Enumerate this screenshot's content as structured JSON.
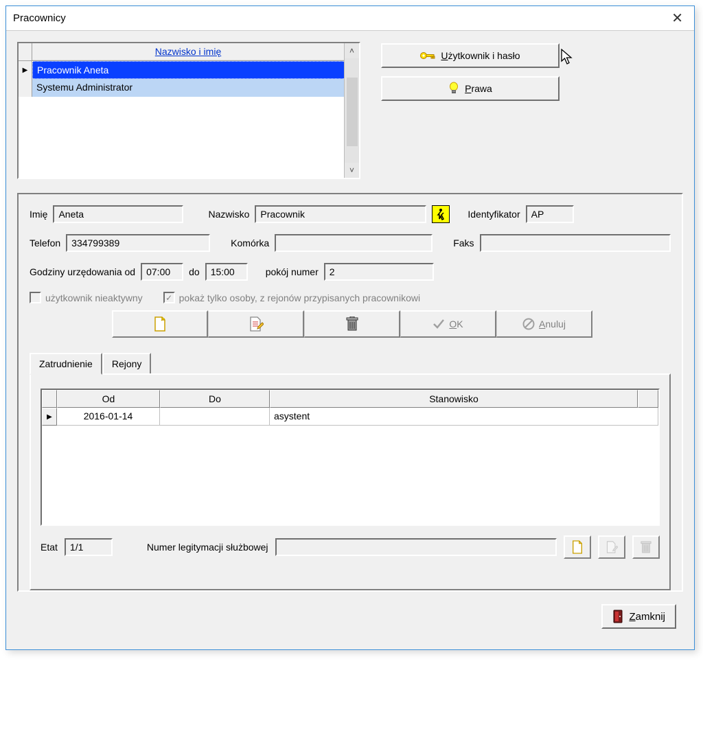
{
  "window": {
    "title": "Pracownicy"
  },
  "employee_list": {
    "header": "Nazwisko i imię",
    "rows": [
      {
        "name": "Pracownik Aneta",
        "selected": true
      },
      {
        "name": "Systemu Administrator",
        "selected": false
      }
    ]
  },
  "side_buttons": {
    "user_password_pre": "U",
    "user_password_rest": "żytkownik i hasło",
    "rights_pre": "P",
    "rights_rest": "rawa"
  },
  "labels": {
    "imie": "Imię",
    "nazwisko": "Nazwisko",
    "identyfikator": "Identyfikator",
    "telefon": "Telefon",
    "komorka": "Komórka",
    "faks": "Faks",
    "godziny": "Godziny urzędowania od",
    "do": "do",
    "pokoj": "pokój numer",
    "chk_inactive": "użytkownik nieaktywny",
    "chk_region": "pokaż tylko osoby, z rejonów przypisanych pracownikowi",
    "etat": "Etat",
    "legit": "Numer legitymacji służbowej"
  },
  "fields": {
    "imie": "Aneta",
    "nazwisko": "Pracownik",
    "identyfikator": "AP",
    "telefon": "334799389",
    "komorka": "",
    "faks": "",
    "godz_od": "07:00",
    "godz_do": "15:00",
    "pokoj": "2",
    "etat": "1/1",
    "legit": ""
  },
  "toolbar": {
    "ok_pre": "O",
    "ok_rest": "K",
    "cancel_pre": "A",
    "cancel_rest": "nuluj"
  },
  "tabs": {
    "employment": "Zatrudnienie",
    "regions": "Rejony"
  },
  "grid": {
    "col_od": "Od",
    "col_do": "Do",
    "col_stan": "Stanowisko",
    "rows": [
      {
        "od": "2016-01-14",
        "do": "",
        "stan": "asystent"
      }
    ]
  },
  "close_btn_pre": "Z",
  "close_btn_rest": "amknij"
}
